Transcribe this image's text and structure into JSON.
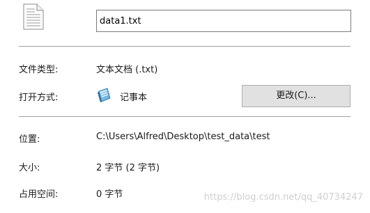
{
  "file": {
    "name": "data1.txt",
    "icon": "text-file-icon"
  },
  "type": {
    "label": "文件类型:",
    "value": "文本文档 (.txt)"
  },
  "opens_with": {
    "label": "打开方式:",
    "app_name": "记事本",
    "app_icon": "notepad-icon",
    "change_button": "更改(C)..."
  },
  "location": {
    "label": "位置:",
    "value": "C:\\Users\\Alfred\\Desktop\\test_data\\test"
  },
  "size": {
    "label": "大小:",
    "value": "2 字节 (2 字节)"
  },
  "size_on_disk": {
    "label": "占用空间:",
    "value": "0 字节"
  },
  "watermark": "https://blog.csdn.net/qq_40734247"
}
